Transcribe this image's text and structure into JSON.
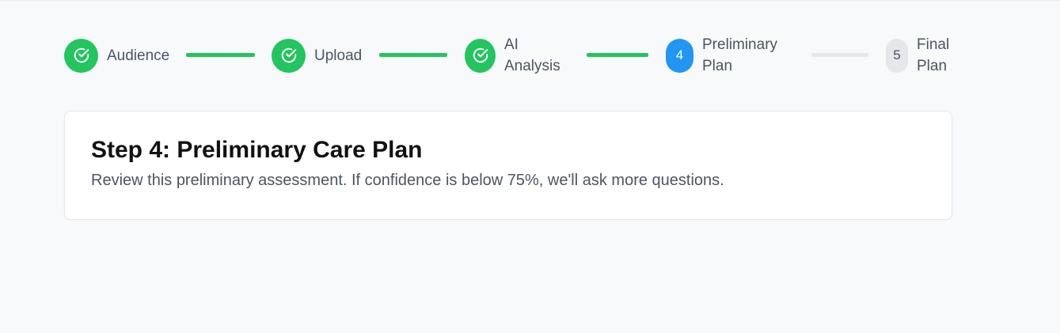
{
  "stepper": {
    "steps": [
      {
        "status": "done",
        "icon": "check-circle-icon",
        "label_line1": "Audience",
        "label_line2": ""
      },
      {
        "status": "done",
        "icon": "check-circle-icon",
        "label_line1": "Upload",
        "label_line2": ""
      },
      {
        "status": "done",
        "icon": "check-circle-icon",
        "label_line1": "AI",
        "label_line2": "Analysis"
      },
      {
        "status": "current",
        "number": "4",
        "label_line1": "Preliminary",
        "label_line2": "Plan"
      },
      {
        "status": "pending",
        "number": "5",
        "label_line1": "Final",
        "label_line2": "Plan"
      }
    ],
    "colors": {
      "done": "#22c55e",
      "current": "#2196f3",
      "pending": "#e5e7eb"
    }
  },
  "main": {
    "title": "Step 4: Preliminary Care Plan",
    "description": "Review this preliminary assessment. If confidence is below 75%, we'll ask more questions."
  }
}
